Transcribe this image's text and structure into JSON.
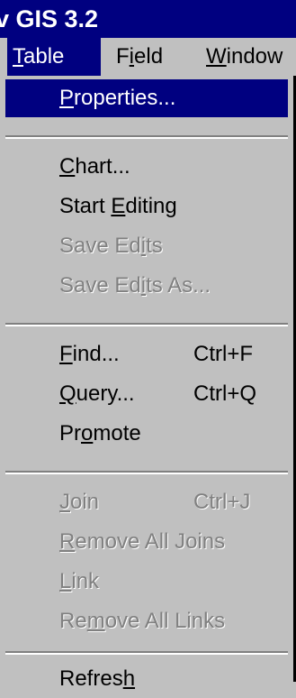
{
  "window": {
    "title": "v GIS 3.2"
  },
  "menubar": {
    "items": [
      {
        "label": "Table",
        "mnemonic_index": 0,
        "active": true
      },
      {
        "label": "Field",
        "mnemonic_index": 1,
        "active": false
      },
      {
        "label": "Window",
        "mnemonic_index": 0,
        "active": false
      }
    ]
  },
  "dropdown": {
    "items": [
      {
        "label": "Properties...",
        "mnemonic_index": 0,
        "shortcut": "",
        "enabled": true,
        "highlighted": true
      },
      {
        "label": "Chart...",
        "mnemonic_index": 0,
        "shortcut": "",
        "enabled": true
      },
      {
        "label": "Start Editing",
        "mnemonic_index": 6,
        "shortcut": "",
        "enabled": true
      },
      {
        "label": "Save Edits",
        "mnemonic_index": 7,
        "shortcut": "",
        "enabled": false
      },
      {
        "label": "Save Edits As...",
        "mnemonic_index": 7,
        "shortcut": "",
        "enabled": false
      },
      {
        "label": "Find...",
        "mnemonic_index": 0,
        "shortcut": "Ctrl+F",
        "enabled": true
      },
      {
        "label": "Query...",
        "mnemonic_index": 0,
        "shortcut": "Ctrl+Q",
        "enabled": true
      },
      {
        "label": "Promote",
        "mnemonic_index": 2,
        "shortcut": "",
        "enabled": true
      },
      {
        "label": "Join",
        "mnemonic_index": 0,
        "shortcut": "Ctrl+J",
        "enabled": false
      },
      {
        "label": "Remove All Joins",
        "mnemonic_index": 0,
        "shortcut": "",
        "enabled": false
      },
      {
        "label": "Link",
        "mnemonic_index": 0,
        "shortcut": "",
        "enabled": false
      },
      {
        "label": "Remove All Links",
        "mnemonic_index": 2,
        "shortcut": "",
        "enabled": false
      },
      {
        "label": "Refresh",
        "mnemonic_index": 6,
        "shortcut": "",
        "enabled": true
      }
    ]
  },
  "colors": {
    "highlight": "#000080",
    "menu_face": "#c0c0c0",
    "disabled_text": "#808080"
  }
}
